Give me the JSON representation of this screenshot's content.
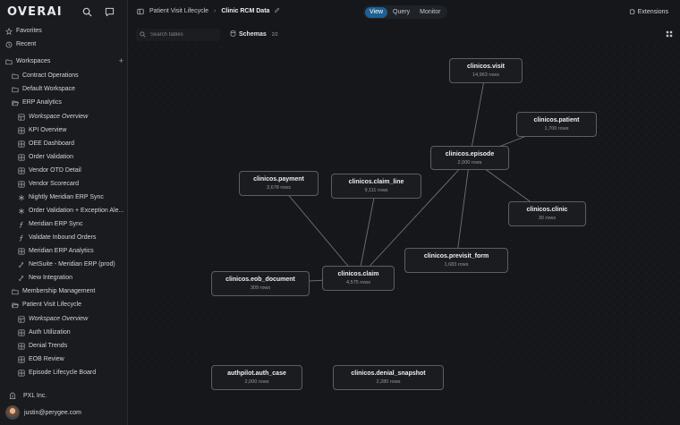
{
  "app": {
    "logo": "OVERAI"
  },
  "sidebar": {
    "items": [
      {
        "label": "Favorites",
        "icon": "star-icon",
        "indent": 0,
        "italic": false
      },
      {
        "label": "Recent",
        "icon": "clock-icon",
        "indent": 0,
        "italic": false
      },
      {
        "label": "Workspaces",
        "icon": "folder-icon",
        "indent": 0,
        "italic": false,
        "add": "+"
      },
      {
        "label": "Contract Operations",
        "icon": "folder-icon",
        "indent": 1,
        "italic": false
      },
      {
        "label": "Default Workspace",
        "icon": "folder-icon",
        "indent": 1,
        "italic": false
      },
      {
        "label": "ERP Analytics",
        "icon": "folder-open-icon",
        "indent": 1,
        "italic": false
      },
      {
        "label": "Workspace Overview",
        "icon": "overview-icon",
        "indent": 2,
        "italic": true
      },
      {
        "label": "KPI Overview",
        "icon": "dashboard-icon",
        "indent": 2,
        "italic": false
      },
      {
        "label": "OEE Dashboard",
        "icon": "dashboard-icon",
        "indent": 2,
        "italic": false
      },
      {
        "label": "Order Validation",
        "icon": "dashboard-icon",
        "indent": 2,
        "italic": false
      },
      {
        "label": "Vendor OTD Detail",
        "icon": "dashboard-icon",
        "indent": 2,
        "italic": false
      },
      {
        "label": "Vendor Scorecard",
        "icon": "dashboard-icon",
        "indent": 2,
        "italic": false
      },
      {
        "label": "Nightly Meridian ERP Sync",
        "icon": "workflow-icon",
        "indent": 2,
        "italic": false
      },
      {
        "label": "Order Validation + Exception Ale...",
        "icon": "workflow-icon",
        "indent": 2,
        "italic": false
      },
      {
        "label": "Meridian ERP Sync",
        "icon": "function-icon",
        "indent": 2,
        "italic": false
      },
      {
        "label": "Validate Inbound Orders",
        "icon": "function-icon",
        "indent": 2,
        "italic": false
      },
      {
        "label": "Meridian ERP Analytics",
        "icon": "dashboard-icon",
        "indent": 2,
        "italic": false
      },
      {
        "label": "NetSuite - Meridian ERP (prod)",
        "icon": "integration-icon",
        "indent": 2,
        "italic": false
      },
      {
        "label": "New Integration",
        "icon": "integration-icon",
        "indent": 2,
        "italic": false
      },
      {
        "label": "Membership Management",
        "icon": "folder-icon",
        "indent": 1,
        "italic": false
      },
      {
        "label": "Patient Visit Lifecycle",
        "icon": "folder-open-icon",
        "indent": 1,
        "italic": false
      },
      {
        "label": "Workspace Overview",
        "icon": "overview-icon",
        "indent": 2,
        "italic": true
      },
      {
        "label": "Auth Utilization",
        "icon": "dashboard-icon",
        "indent": 2,
        "italic": false
      },
      {
        "label": "Denial Trends",
        "icon": "dashboard-icon",
        "indent": 2,
        "italic": false
      },
      {
        "label": "EOB Review",
        "icon": "dashboard-icon",
        "indent": 2,
        "italic": false
      },
      {
        "label": "Episode Lifecycle Board",
        "icon": "dashboard-icon",
        "indent": 2,
        "italic": false
      }
    ],
    "org": "PXL Inc.",
    "user": "justin@perygee.com"
  },
  "header": {
    "breadcrumb_parent": "Patient Visit Lifecycle",
    "breadcrumb_current": "Clinic RCM Data",
    "modes": [
      {
        "label": "View",
        "active": true
      },
      {
        "label": "Query",
        "active": false
      },
      {
        "label": "Monitor",
        "active": false
      }
    ],
    "extensions_label": "Extensions"
  },
  "toolbar": {
    "search_placeholder": "Search tables",
    "schemas_label": "Schemas",
    "schemas_count": "2/2"
  },
  "colors": {
    "accent": "#1f5f92",
    "node_border": "#5a5f67",
    "edge": "#6e737b"
  },
  "tables": [
    {
      "name": "clinicos.visit",
      "rows": "14,963 rows"
    },
    {
      "name": "clinicos.patient",
      "rows": "1,700 rows"
    },
    {
      "name": "clinicos.episode",
      "rows": "2,000 rows"
    },
    {
      "name": "clinicos.payment",
      "rows": "3,678 rows"
    },
    {
      "name": "clinicos.claim_line",
      "rows": "9,111 rows"
    },
    {
      "name": "clinicos.clinic",
      "rows": "30 rows"
    },
    {
      "name": "clinicos.previsit_form",
      "rows": "1,683 rows"
    },
    {
      "name": "clinicos.eob_document",
      "rows": "309 rows"
    },
    {
      "name": "clinicos.claim",
      "rows": "4,575 rows"
    },
    {
      "name": "authpilot.auth_case",
      "rows": "2,000 rows"
    },
    {
      "name": "clinicos.denial_snapshot",
      "rows": "2,280 rows"
    }
  ]
}
